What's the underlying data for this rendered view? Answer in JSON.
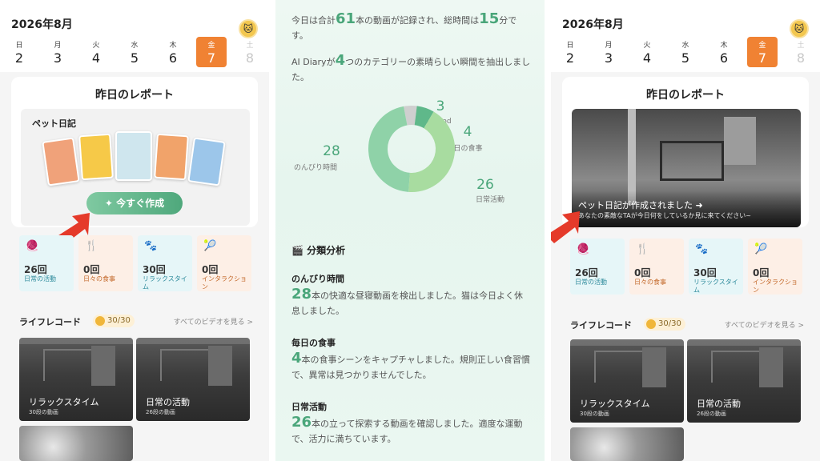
{
  "calendar": {
    "title": "2026年8月",
    "avatar_icon": "cat-avatar-icon",
    "days": [
      {
        "weekday": "日",
        "date": "2"
      },
      {
        "weekday": "月",
        "date": "3"
      },
      {
        "weekday": "火",
        "date": "4"
      },
      {
        "weekday": "水",
        "date": "5"
      },
      {
        "weekday": "木",
        "date": "6"
      },
      {
        "weekday": "金",
        "date": "7"
      },
      {
        "weekday": "土",
        "date": "8"
      }
    ],
    "active_index": 5
  },
  "report": {
    "title": "昨日のレポート",
    "diary_label": "ペット日記",
    "create_button": "今すぐ作成",
    "created_title": "ペット日記が作成されました",
    "created_subtitle": "あなたの素敵なTAが今日何をしているか見に来てください~"
  },
  "stats": [
    {
      "count": "26回",
      "label": "日常の活動",
      "icon": "ball-icon"
    },
    {
      "count": "0回",
      "label": "日々の食事",
      "icon": "utensils-icon"
    },
    {
      "count": "30回",
      "label": "リラックスタイム",
      "icon": "paw-icon"
    },
    {
      "count": "0回",
      "label": "インタラクション",
      "icon": "toy-icon"
    }
  ],
  "life_record": {
    "title": "ライフレコード",
    "badge": "30/30",
    "view_all": "すべてのビデオを見る >",
    "videos": [
      {
        "title": "リラックスタイム",
        "sub": "30段の動画"
      },
      {
        "title": "日常の活動",
        "sub": "26段の動画"
      }
    ]
  },
  "summary": {
    "line1_pre": "今日は合計",
    "line1_n1": "61",
    "line1_mid": "本の動画が記録され、総時間は",
    "line1_n2": "15",
    "line1_post": "分です。",
    "line2_pre": "AI Diaryが",
    "line2_n": "4",
    "line2_post": "つのカテゴリーの素晴らしい瞬間を抽出しました。"
  },
  "chart_data": {
    "type": "pie",
    "categories": [
      "out_food",
      "毎日の食事",
      "日常活動",
      "のんびり時間"
    ],
    "values": [
      3,
      4,
      26,
      28
    ],
    "colors": [
      "#cfcfcf",
      "#5fb88a",
      "#a8dca0",
      "#8fd2a8"
    ]
  },
  "analysis": {
    "heading": "分類分析",
    "heading_icon": "clapperboard-icon",
    "sections": [
      {
        "title": "のんびり時間",
        "num": "28",
        "text": "本の快適な昼寝動画を検出しました。猫は今日よく休息しました。"
      },
      {
        "title": "毎日の食事",
        "num": "4",
        "text": "本の食事シーンをキャプチャしました。規則正しい食習慣で、異常は見つかりませんでした。"
      },
      {
        "title": "日常活動",
        "num": "26",
        "text": "本の立って探索する動画を確認しました。適度な運動で、活力に満ちています。"
      }
    ]
  },
  "colors": {
    "accent_orange": "#f08233",
    "accent_green": "#4aa67a",
    "arrow_red": "#e53a2a"
  }
}
